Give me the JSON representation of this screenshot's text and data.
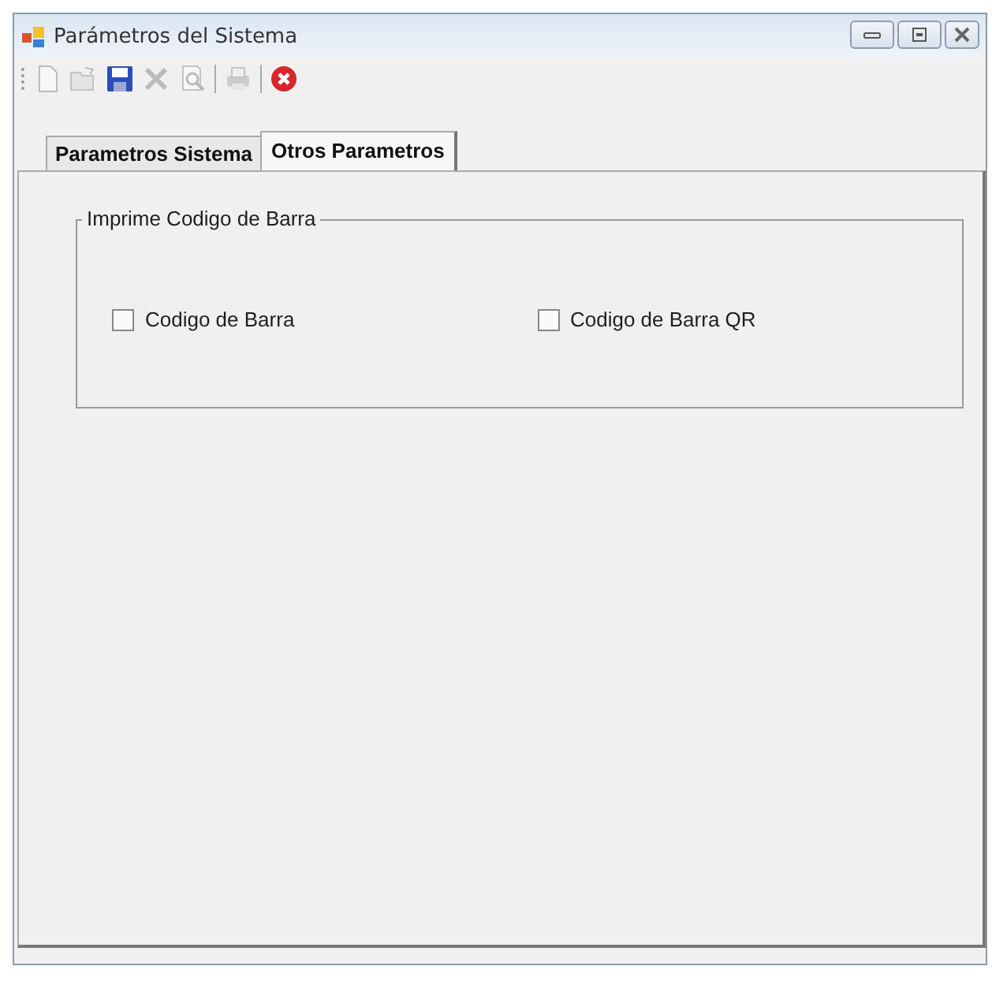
{
  "window": {
    "title": "Parámetros del Sistema"
  },
  "toolbar": [
    {
      "kind": "new",
      "disabled": true
    },
    {
      "kind": "open",
      "disabled": true
    },
    {
      "kind": "save",
      "disabled": false
    },
    {
      "kind": "delete",
      "disabled": true
    },
    {
      "kind": "preview",
      "disabled": true
    },
    {
      "kind": "separator"
    },
    {
      "kind": "print",
      "disabled": true
    },
    {
      "kind": "separator"
    },
    {
      "kind": "exit",
      "disabled": false
    }
  ],
  "tabs": [
    {
      "label": "Parametros Sistema",
      "selected": false
    },
    {
      "label": "Otros Parametros",
      "selected": true
    }
  ],
  "group": {
    "title": "Imprime Codigo de Barra",
    "checkboxes": [
      {
        "label": "Codigo de Barra",
        "checked": false
      },
      {
        "label": "Codigo de Barra QR",
        "checked": false
      }
    ]
  }
}
